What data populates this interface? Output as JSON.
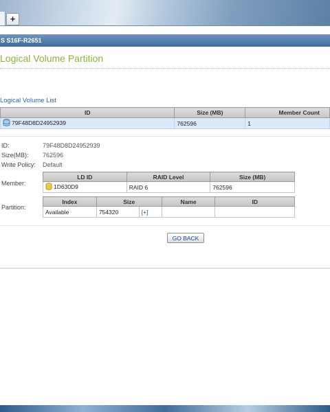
{
  "browser": {
    "new_tab_label": "+"
  },
  "device_bar": {
    "title": "S S16F-R2651"
  },
  "page": {
    "title": "Logical Volume Partition"
  },
  "logical_volume_list": {
    "label": "Logical Volume List",
    "columns": [
      "ID",
      "Size (MB)",
      "Member Count"
    ],
    "rows": [
      {
        "id": "79F48D8D24952939",
        "size_mb": "762596",
        "member_count": "1"
      }
    ]
  },
  "details": {
    "id_label": "ID:",
    "id_value": "79F48D8D24952939",
    "size_label": "Size(MB):",
    "size_value": "762596",
    "write_policy_label": "Write Policy:",
    "write_policy_value": "Default",
    "member_label": "Member:",
    "partition_label": "Partition:"
  },
  "member_table": {
    "columns": [
      "LD ID",
      "RAID Level",
      "Size (MB)"
    ],
    "rows": [
      {
        "ld_id": "1D630D9",
        "raid_level": "RAID 6",
        "size_mb": "762596"
      }
    ]
  },
  "partition_table": {
    "columns": [
      "Index",
      "Size",
      "Name",
      "ID"
    ],
    "rows": [
      {
        "index": "Available",
        "size": "754320",
        "action": "[+]",
        "name": "",
        "id": ""
      }
    ]
  },
  "actions": {
    "go_back_label": "GO BACK"
  },
  "colors": {
    "title_green": "#8db43a",
    "link_blue": "#2a66a6",
    "selected_row": "#dce9f8"
  },
  "icons": {
    "volume_icon": "database-icon",
    "ld_icon": "disk-icon"
  }
}
